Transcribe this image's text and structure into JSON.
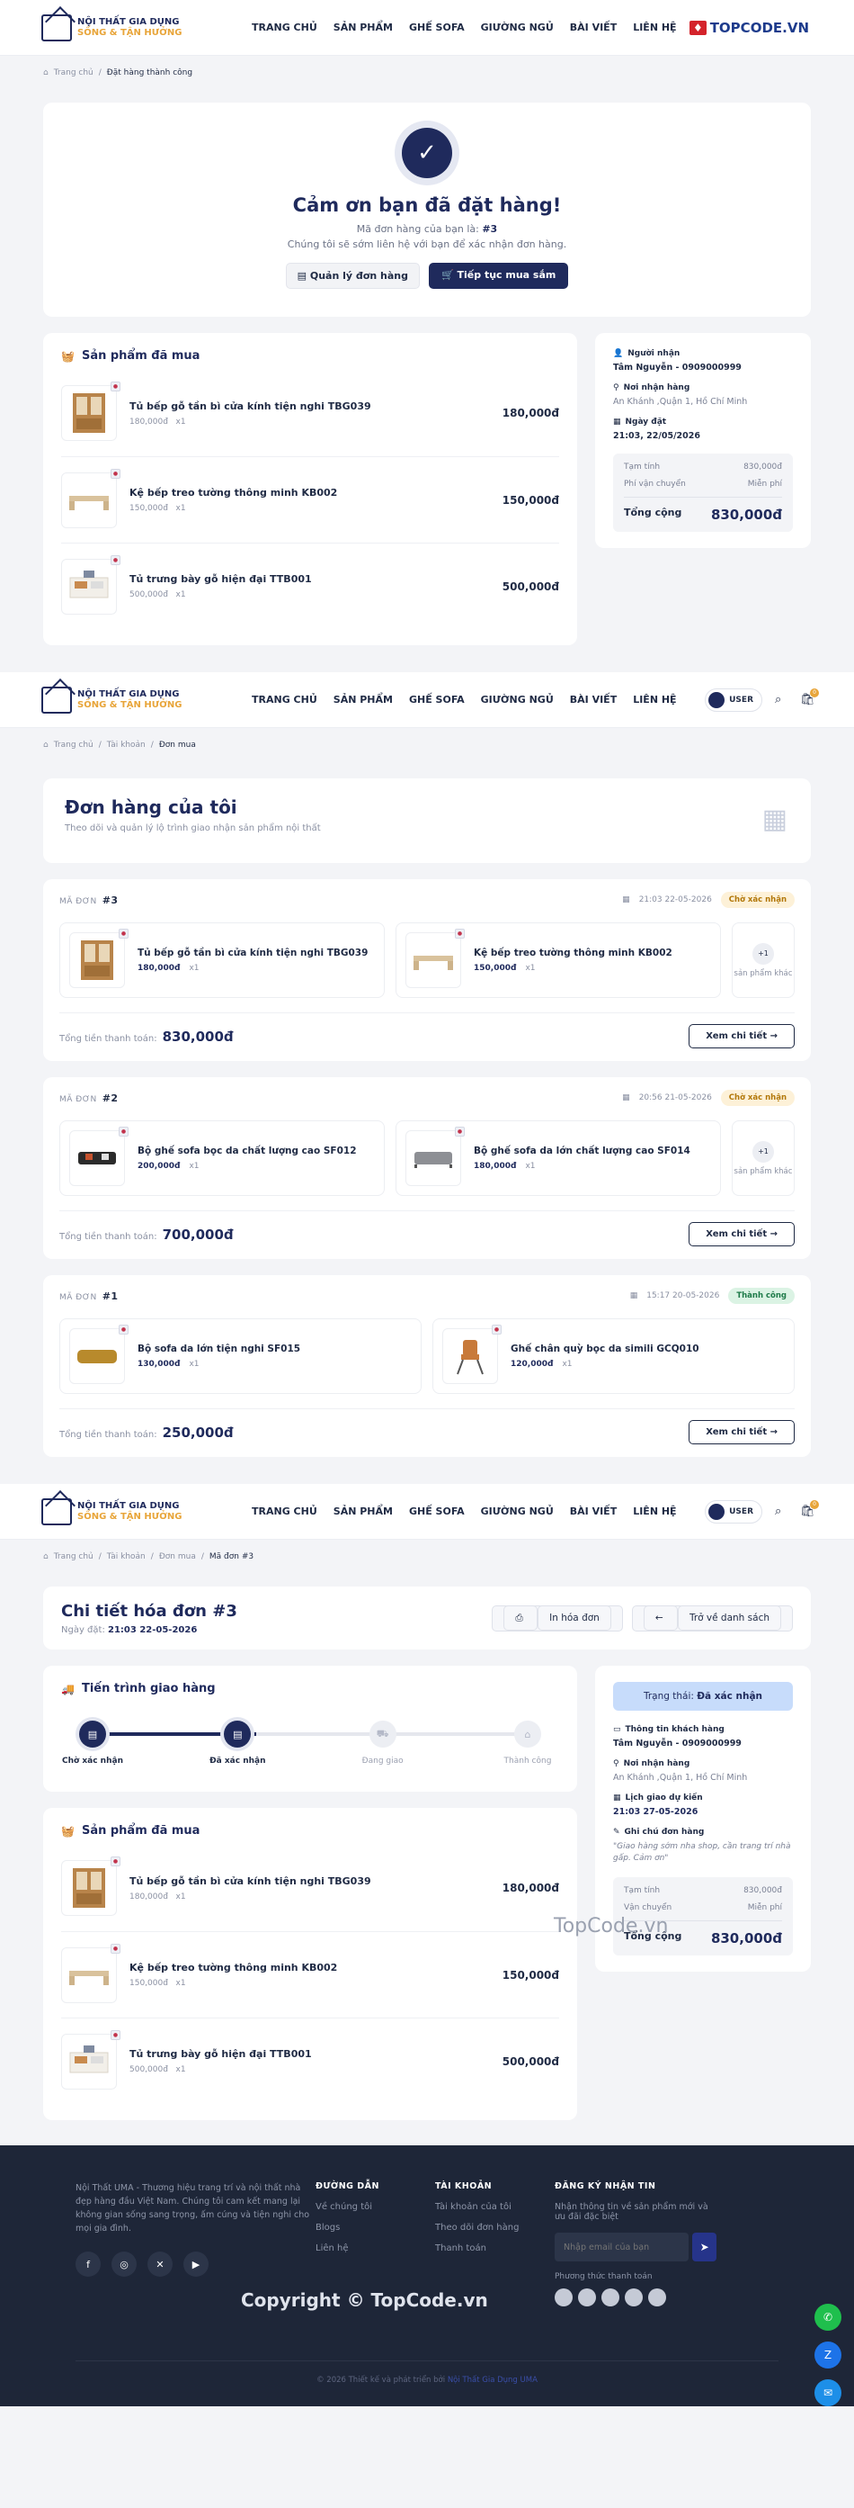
{
  "header": {
    "logo_line1": "NỘI THẤT GIA DỤNG",
    "logo_line2": "SỐNG & TẬN HƯỞNG",
    "nav": [
      "TRANG CHỦ",
      "SẢN PHẨM",
      "GHẾ SOFA",
      "GIƯỜNG NGỦ",
      "BÀI VIẾT",
      "LIÊN HỆ"
    ],
    "user": "USER",
    "cart_count": "0",
    "watermark": "TOPCODE.VN"
  },
  "success": {
    "breadcrumb": [
      "Trang chủ",
      "Đặt hàng thành công"
    ],
    "title": "Cảm ơn bạn đã đặt hàng!",
    "order_prefix": "Mã đơn hàng của bạn là:",
    "order_no": "#3",
    "sub": "Chúng tôi sẽ sớm liên hệ với bạn để xác nhận đơn hàng.",
    "btn_manage": "Quản lý đơn hàng",
    "btn_continue": "Tiếp tục mua sắm",
    "products_title": "Sản phẩm đã mua",
    "products": [
      {
        "name": "Tủ bếp gỗ tần bì cửa kính tiện nghi TBG039",
        "price": "180,000đ",
        "qty": "x1",
        "total": "180,000đ"
      },
      {
        "name": "Kệ bếp treo tường thông minh KB002",
        "price": "150,000đ",
        "qty": "x1",
        "total": "150,000đ"
      },
      {
        "name": "Tủ trưng bày gỗ hiện đại TTB001",
        "price": "500,000đ",
        "qty": "x1",
        "total": "500,000đ"
      }
    ],
    "receiver_label": "Người nhận",
    "receiver": "Tâm Nguyễn - 0909000999",
    "addr_label": "Nơi nhận hàng",
    "addr": "An Khánh ,Quận 1, Hồ Chí Minh",
    "date_label": "Ngày đặt",
    "date": "21:03, 22/05/2026",
    "subtotal_label": "Tạm tính",
    "subtotal": "830,000đ",
    "ship_label": "Phí vận chuyển",
    "ship": "Miễn phí",
    "total_label": "Tổng cộng",
    "total": "830,000đ"
  },
  "orders": {
    "breadcrumb": [
      "Trang chủ",
      "Tài khoản",
      "Đơn mua"
    ],
    "title": "Đơn hàng của tôi",
    "sub": "Theo dõi và quản lý lộ trình giao nhận sản phẩm nội thất",
    "id_label": "MÃ ĐƠN",
    "total_label": "Tổng tiền thanh toán:",
    "detail_btn": "Xem chi tiết",
    "more_label": "sản phẩm khác",
    "list": [
      {
        "id": "#3",
        "time": "21:03 22-05-2026",
        "status": "Chờ xác nhận",
        "ok": false,
        "total": "830,000đ",
        "more": "+1",
        "items": [
          {
            "name": "Tủ bếp gỗ tần bì cửa kính tiện nghi TBG039",
            "price": "180,000đ",
            "qty": "x1",
            "img": "cabinet"
          },
          {
            "name": "Kệ bếp treo tường thông minh KB002",
            "price": "150,000đ",
            "qty": "x1",
            "img": "shelf"
          }
        ]
      },
      {
        "id": "#2",
        "time": "20:56 21-05-2026",
        "status": "Chờ xác nhận",
        "ok": false,
        "total": "700,000đ",
        "more": "+1",
        "items": [
          {
            "name": "Bộ ghế sofa bọc da chất lượng cao SF012",
            "price": "200,000đ",
            "qty": "x1",
            "img": "sofa-black"
          },
          {
            "name": "Bộ ghế sofa da lớn chất lượng cao SF014",
            "price": "180,000đ",
            "qty": "x1",
            "img": "sofa-grey"
          }
        ]
      },
      {
        "id": "#1",
        "time": "15:17 20-05-2026",
        "status": "Thành công",
        "ok": true,
        "total": "250,000đ",
        "more": "",
        "items": [
          {
            "name": "Bộ sofa da lớn tiện nghi SF015",
            "price": "130,000đ",
            "qty": "x1",
            "img": "sofa-gold"
          },
          {
            "name": "Ghế chân quỳ bọc da simili GCQ010",
            "price": "120,000đ",
            "qty": "x1",
            "img": "chair"
          }
        ]
      }
    ]
  },
  "detail": {
    "breadcrumb": [
      "Trang chủ",
      "Tài khoản",
      "Đơn mua",
      "Mã đơn #3"
    ],
    "title": "Chi tiết hóa đơn #3",
    "date_prefix": "Ngày đặt:",
    "date": "21:03 22-05-2026",
    "print_btn": "In hóa đơn",
    "back_btn": "Trở về danh sách",
    "progress_title": "Tiến trình giao hàng",
    "steps": [
      "Chờ xác nhận",
      "Đã xác nhận",
      "Đang giao",
      "Thành công"
    ],
    "progress_value": 0.33,
    "products_title": "Sản phẩm đã mua",
    "status_prefix": "Trạng thái:",
    "status": "Đã xác nhận",
    "cust_label": "Thông tin khách hàng",
    "cust": "Tâm Nguyễn - 0909000999",
    "addr_label": "Nơi nhận hàng",
    "addr": "An Khánh ,Quận 1, Hồ Chí Minh",
    "eta_label": "Lịch giao dự kiến",
    "eta": "21:03 27-05-2026",
    "note_label": "Ghi chú đơn hàng",
    "note": "\"Giao hàng sớm nha shop, cần trang trí nhà gấp. Cảm ơn\"",
    "subtotal_label": "Tạm tính",
    "subtotal": "830,000đ",
    "ship_label": "Vận chuyển",
    "ship": "Miễn phí",
    "total_label": "Tổng cộng",
    "total": "830,000đ"
  },
  "footer": {
    "about": "Nội Thất UMA - Thương hiệu trang trí và nội thất nhà đẹp hàng đầu Việt Nam. Chúng tôi cam kết mang lại không gian sống sang trọng, ấm cúng và tiện nghi cho mọi gia đình.",
    "guide_title": "ĐƯỜNG DẪN",
    "guide": [
      "Về chúng tôi",
      "Blogs",
      "Liên hệ"
    ],
    "acc_title": "TÀI KHOẢN",
    "acc": [
      "Tài khoản của tôi",
      "Theo dõi đơn hàng",
      "Thanh toán"
    ],
    "news_title": "ĐĂNG KÝ NHẬN TIN",
    "news_sub": "Nhận thông tin về sản phẩm mới và ưu đãi đặc biệt",
    "email_ph": "Nhập email của bạn",
    "pay_label": "Phương thức thanh toán",
    "copyright": "© 2026 Thiết kế và phát triển bởi",
    "copyright_by": "Nội Thất Gia Dụng UMA",
    "wm1": "Copyright © TopCode.vn",
    "wm2": "TopCode.vn"
  }
}
